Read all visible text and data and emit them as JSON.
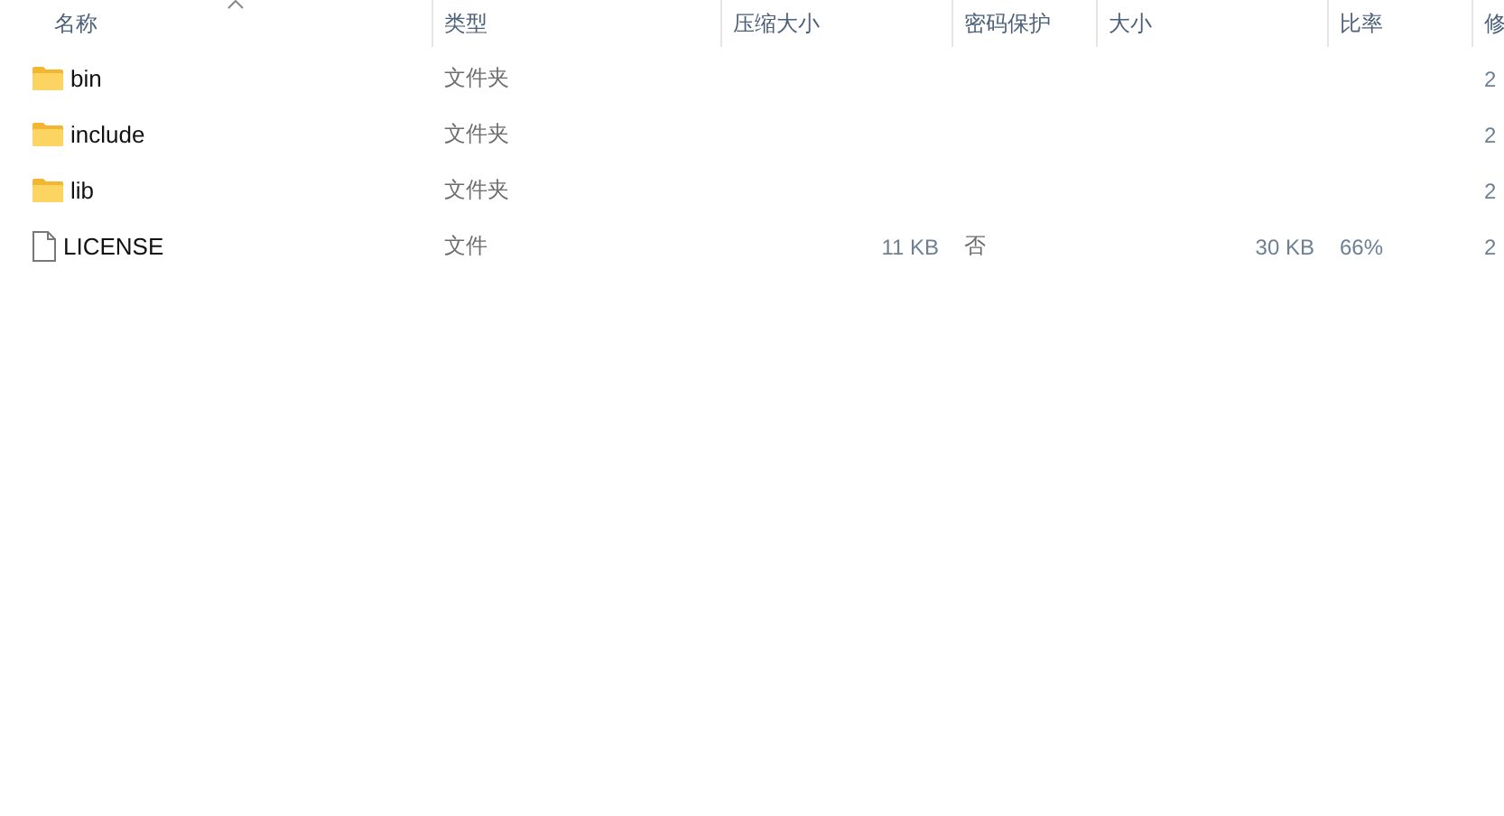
{
  "columns": [
    {
      "label": "名称",
      "sorted": true
    },
    {
      "label": "类型",
      "sorted": false
    },
    {
      "label": "压缩大小",
      "sorted": false
    },
    {
      "label": "密码保护",
      "sorted": false
    },
    {
      "label": "大小",
      "sorted": false
    },
    {
      "label": "比率",
      "sorted": false
    },
    {
      "label": "修",
      "sorted": false
    }
  ],
  "rows": [
    {
      "kind": "folder",
      "name": "bin",
      "type": "文件夹",
      "packed": "",
      "protected": "",
      "size": "",
      "ratio": "",
      "modified": "2"
    },
    {
      "kind": "folder",
      "name": "include",
      "type": "文件夹",
      "packed": "",
      "protected": "",
      "size": "",
      "ratio": "",
      "modified": "2"
    },
    {
      "kind": "folder",
      "name": "lib",
      "type": "文件夹",
      "packed": "",
      "protected": "",
      "size": "",
      "ratio": "",
      "modified": "2"
    },
    {
      "kind": "file",
      "name": "LICENSE",
      "type": "文件",
      "packed": "11 KB",
      "protected": "否",
      "size": "30 KB",
      "ratio": "66%",
      "modified": "2"
    }
  ]
}
